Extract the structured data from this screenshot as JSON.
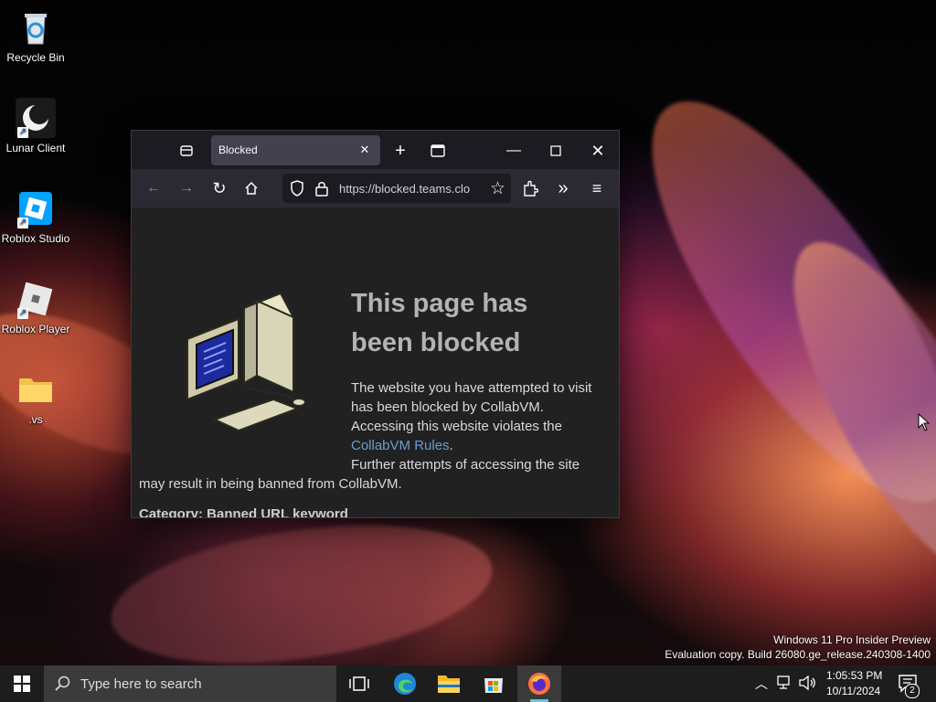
{
  "desktop": {
    "icons": [
      {
        "label": "Recycle Bin",
        "icon": "recycle-bin-icon"
      },
      {
        "label": "Lunar Client",
        "icon": "lunar-client-icon"
      },
      {
        "label": "Roblox Studio",
        "icon": "roblox-studio-icon"
      },
      {
        "label": "Roblox Player",
        "icon": "roblox-player-icon"
      },
      {
        "label": ".vs",
        "icon": "folder-icon"
      }
    ],
    "watermark": {
      "line1": "Windows 11 Pro Insider Preview",
      "line2": "Evaluation copy. Build 26080.ge_release.240308-1400"
    }
  },
  "browser": {
    "tab_title": "Blocked",
    "url": "https://blocked.teams.clo",
    "page": {
      "headline_line1": "This page has",
      "headline_line2": "been blocked",
      "p1": "The website you have attempted to visit",
      "p2": "has been blocked by CollabVM.",
      "p3": "Accessing this website violates the",
      "link": "CollabVM Rules",
      "link_after": ".",
      "p4": "Further attempts of accessing the site",
      "p5": "may result in being banned from CollabVM.",
      "p6_partial": "Category: Banned URL keyword"
    }
  },
  "taskbar": {
    "search_placeholder": "Type here to search",
    "time": "1:05:53 PM",
    "date": "10/11/2024",
    "notification_count": "2"
  },
  "colors": {
    "browser_bg": "#1c1b22",
    "tab_active": "#42414d",
    "page_bg": "#212121",
    "link": "#6b9bd1",
    "taskbar": "#1d1d1d"
  }
}
